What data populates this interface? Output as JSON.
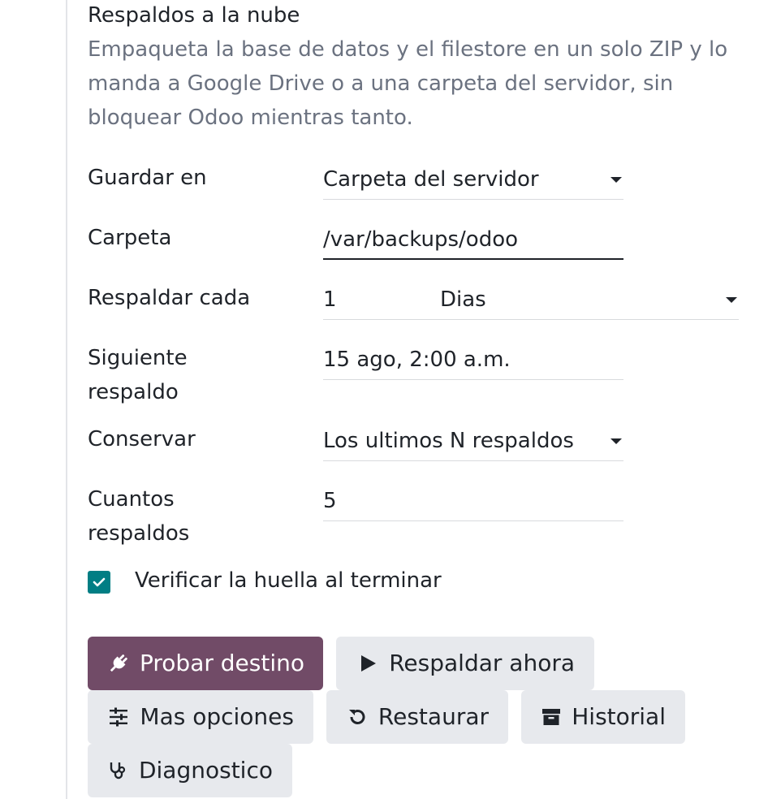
{
  "section": {
    "title": "Respaldos a la nube",
    "description": "Empaqueta la base de datos y el filestore en un solo ZIP y lo manda a Google Drive o a una carpeta del servidor, sin bloquear Odoo mientras tanto."
  },
  "fields": {
    "storage": {
      "label": "Guardar en",
      "value": "Carpeta del servidor"
    },
    "folder": {
      "label": "Carpeta",
      "value": "/var/backups/odoo"
    },
    "interval": {
      "label": "Respaldar cada",
      "number": "1",
      "unit": "Dias"
    },
    "next_backup": {
      "label": "Siguiente respaldo",
      "value": "15 ago, 2:00 a.m."
    },
    "retention": {
      "label": "Conservar",
      "value": "Los ultimos N respaldos"
    },
    "count": {
      "label": "Cuantos respaldos",
      "value": "5"
    }
  },
  "verify_checkbox": {
    "label": "Verificar la huella al terminar",
    "checked": true
  },
  "buttons": {
    "test": "Probar destino",
    "backup_now": "Respaldar ahora",
    "more_options": "Mas opciones",
    "restore": "Restaurar",
    "history": "Historial",
    "diagnostics": "Diagnostico"
  },
  "icons": {
    "test": "plug-icon",
    "backup_now": "play-icon",
    "more_options": "sliders-icon",
    "restore": "undo-icon",
    "history": "archive-icon",
    "diagnostics": "stethoscope-icon",
    "checkbox": "check-icon",
    "dropdown": "caret-down-icon"
  },
  "colors": {
    "primary": "#714b67",
    "checkbox": "#017e84",
    "secondary_button": "#e7e9ed",
    "muted_text": "#6b7280"
  }
}
